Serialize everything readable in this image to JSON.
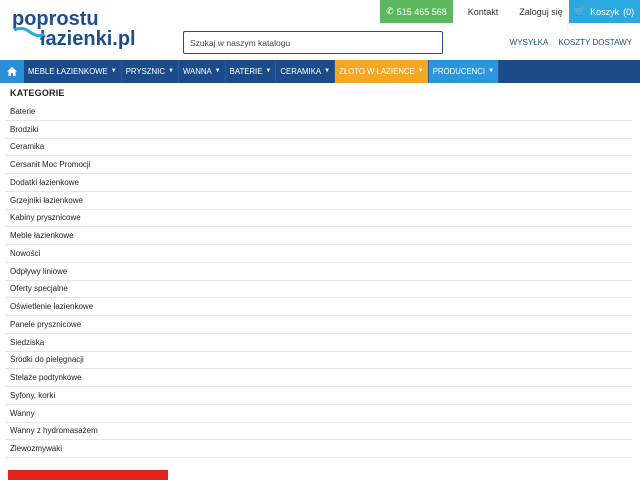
{
  "logo": {
    "line1": "poprostu",
    "line2": "łazienki.pl"
  },
  "topbar": {
    "phone": "515 465 568",
    "contact": "Kontakt",
    "login": "Zaloguj się",
    "cart_label": "Koszyk",
    "cart_count": "(0)"
  },
  "search": {
    "placeholder": "Szukaj w naszym katalogu"
  },
  "shiplinks": {
    "shipping": "WYSYŁKA",
    "costs": "KOSZTY DOSTAWY"
  },
  "nav": {
    "items": [
      {
        "label": "MEBLE ŁAZIENKOWE"
      },
      {
        "label": "PRYSZNIC"
      },
      {
        "label": "WANNA"
      },
      {
        "label": "BATERIE"
      },
      {
        "label": "CERAMIKA"
      },
      {
        "label": "ZŁOTO W ŁAZIENCE"
      },
      {
        "label": "PRODUCENCI"
      }
    ]
  },
  "categories": {
    "title": "KATEGORIE",
    "items": [
      "Baterie",
      "Brodziki",
      "Ceramika",
      "Cersanit Moc Promocji",
      "Dodatki łazienkowe",
      "Grzejniki łazienkowe",
      "Kabiny prysznicowe",
      "Meble łazienkowe",
      "Nowości",
      "Odpływy liniowe",
      "Oferty specjalne",
      "Oświetlenie łazienkowe",
      "Panele prysznicowe",
      "Siedziska",
      "Środki do pielęgnacji",
      "Stelaże podtynkowe",
      "Syfony, korki",
      "Wanny",
      "Wanny z hydromasażem",
      "Zlewozmywaki"
    ]
  },
  "colors": {
    "nav_bg": "#1b4b88",
    "accent_blue": "#29a9e0",
    "accent_green": "#5cb85c",
    "accent_orange": "#f5a623",
    "promo_red": "#e2231a"
  },
  "icons": {
    "home": "home-icon",
    "phone": "phone-icon",
    "cart": "cart-icon",
    "chevron": "chevron-down-icon"
  }
}
